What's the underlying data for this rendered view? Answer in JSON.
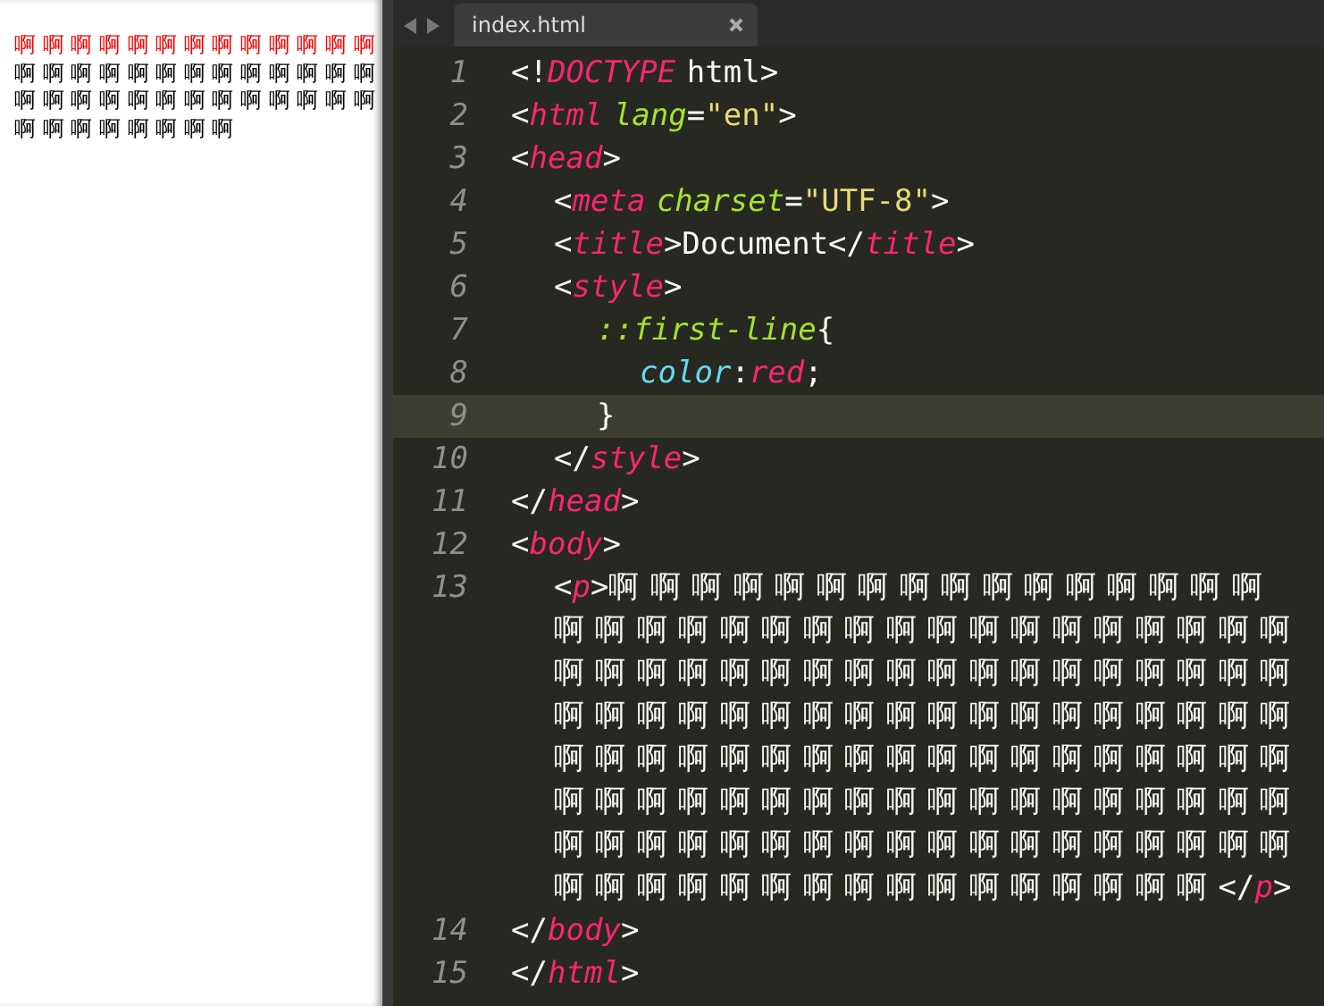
{
  "browser": {
    "lines": [
      {
        "text": "啊 啊 啊 啊 啊 啊 啊 啊 啊 啊 啊 啊 啊",
        "first_line": true
      },
      {
        "text": "啊 啊 啊 啊 啊 啊 啊 啊 啊 啊 啊 啊 啊",
        "first_line": false
      },
      {
        "text": "啊 啊 啊 啊 啊 啊 啊 啊 啊 啊 啊 啊 啊",
        "first_line": false
      },
      {
        "text": "啊 啊 啊 啊 啊 啊 啊 啊",
        "first_line": false
      }
    ]
  },
  "editor": {
    "tabs": [
      {
        "label": "index.html",
        "selected": true
      }
    ],
    "lines": [
      {
        "number": "1",
        "current": false,
        "wraps": [
          [
            {
              "text": "<!",
              "kind": "punct"
            },
            {
              "text": "DOCTYPE",
              "kind": "tag"
            },
            {
              "text": " html>",
              "kind": "punct"
            }
          ]
        ]
      },
      {
        "number": "2",
        "current": false,
        "wraps": [
          [
            {
              "text": "<",
              "kind": "punct"
            },
            {
              "text": "html",
              "kind": "tag"
            },
            {
              "text": " lang",
              "kind": "attr"
            },
            {
              "text": "=",
              "kind": "punct"
            },
            {
              "text": "\"en\"",
              "kind": "string"
            },
            {
              "text": ">",
              "kind": "punct"
            }
          ]
        ]
      },
      {
        "number": "3",
        "current": false,
        "wraps": [
          [
            {
              "text": "<",
              "kind": "punct"
            },
            {
              "text": "head",
              "kind": "tag"
            },
            {
              "text": ">",
              "kind": "punct"
            }
          ]
        ],
        "children": [
          {
            "number": "4",
            "current": false,
            "wraps": [
              [
                {
                  "text": "<",
                  "kind": "punct"
                },
                {
                  "text": "meta",
                  "kind": "tag"
                },
                {
                  "text": " charset",
                  "kind": "attr"
                },
                {
                  "text": "=",
                  "kind": "punct"
                },
                {
                  "text": "\"UTF-8\"",
                  "kind": "string"
                },
                {
                  "text": ">",
                  "kind": "punct"
                }
              ]
            ]
          },
          {
            "number": "5",
            "current": false,
            "wraps": [
              [
                {
                  "text": "<",
                  "kind": "punct"
                },
                {
                  "text": "title",
                  "kind": "tag"
                },
                {
                  "text": ">Document</",
                  "kind": "punct"
                },
                {
                  "text": "title",
                  "kind": "tag"
                },
                {
                  "text": ">",
                  "kind": "punct"
                }
              ]
            ]
          },
          {
            "number": "6",
            "current": false,
            "wraps": [
              [
                {
                  "text": "<",
                  "kind": "punct"
                },
                {
                  "text": "style",
                  "kind": "tag"
                },
                {
                  "text": ">",
                  "kind": "punct"
                }
              ]
            ],
            "children": [
              {
                "number": "7",
                "current": false,
                "wraps": [
                  [
                    {
                      "text": "::first-line",
                      "kind": "attr"
                    },
                    {
                      "text": "{",
                      "kind": "punct"
                    }
                  ]
                ],
                "children": [
                  {
                    "number": "8",
                    "current": false,
                    "wraps": [
                      [
                        {
                          "text": "color",
                          "kind": "prop"
                        },
                        {
                          "text": ":",
                          "kind": "punct"
                        },
                        {
                          "text": "red",
                          "kind": "value"
                        },
                        {
                          "text": ";",
                          "kind": "punct"
                        }
                      ]
                    ]
                  }
                ]
              },
              {
                "number": "9",
                "current": true,
                "wraps": [
                  [
                    {
                      "text": "}",
                      "kind": "punct"
                    }
                  ]
                ]
              }
            ]
          },
          {
            "number": "10",
            "current": false,
            "wraps": [
              [
                {
                  "text": "</",
                  "kind": "punct"
                },
                {
                  "text": "style",
                  "kind": "tag"
                },
                {
                  "text": ">",
                  "kind": "punct"
                }
              ]
            ]
          }
        ]
      },
      {
        "number": "11",
        "current": false,
        "wraps": [
          [
            {
              "text": "</",
              "kind": "punct"
            },
            {
              "text": "head",
              "kind": "tag"
            },
            {
              "text": ">",
              "kind": "punct"
            }
          ]
        ]
      },
      {
        "number": "12",
        "current": false,
        "wraps": [
          [
            {
              "text": "<",
              "kind": "punct"
            },
            {
              "text": "body",
              "kind": "tag"
            },
            {
              "text": ">",
              "kind": "punct"
            }
          ]
        ],
        "children": [
          {
            "number": "13",
            "current": false,
            "wraps": [
              [
                {
                  "text": "<",
                  "kind": "punct"
                },
                {
                  "text": "p",
                  "kind": "tag"
                },
                {
                  "text": ">啊 啊 啊 啊 啊 啊 啊 啊 啊 啊 啊 啊 啊 啊 啊 啊",
                  "kind": "punct"
                }
              ],
              [
                {
                  "text": "啊 啊 啊 啊 啊 啊 啊 啊 啊 啊 啊 啊 啊 啊 啊 啊 啊 啊",
                  "kind": "punct"
                }
              ],
              [
                {
                  "text": "啊 啊 啊 啊 啊 啊 啊 啊 啊 啊 啊 啊 啊 啊 啊 啊 啊 啊",
                  "kind": "punct"
                }
              ],
              [
                {
                  "text": "啊 啊 啊 啊 啊 啊 啊 啊 啊 啊 啊 啊 啊 啊 啊 啊 啊 啊",
                  "kind": "punct"
                }
              ],
              [
                {
                  "text": "啊 啊 啊 啊 啊 啊 啊 啊 啊 啊 啊 啊 啊 啊 啊 啊 啊 啊",
                  "kind": "punct"
                }
              ],
              [
                {
                  "text": "啊 啊 啊 啊 啊 啊 啊 啊 啊 啊 啊 啊 啊 啊 啊 啊 啊 啊",
                  "kind": "punct"
                }
              ],
              [
                {
                  "text": "啊 啊 啊 啊 啊 啊 啊 啊 啊 啊 啊 啊 啊 啊 啊 啊 啊 啊",
                  "kind": "punct"
                }
              ],
              [
                {
                  "text": "啊 啊 啊 啊 啊 啊 啊 啊 啊 啊 啊 啊 啊 啊 啊 啊 </",
                  "kind": "punct"
                },
                {
                  "text": "p",
                  "kind": "tag"
                },
                {
                  "text": ">",
                  "kind": "punct"
                }
              ]
            ]
          }
        ]
      },
      {
        "number": "14",
        "current": false,
        "wraps": [
          [
            {
              "text": "</",
              "kind": "punct"
            },
            {
              "text": "body",
              "kind": "tag"
            },
            {
              "text": ">",
              "kind": "punct"
            }
          ]
        ]
      },
      {
        "number": "15",
        "current": false,
        "wraps": [
          [
            {
              "text": "</",
              "kind": "punct"
            },
            {
              "text": "html",
              "kind": "tag"
            },
            {
              "text": ">",
              "kind": "punct"
            }
          ]
        ]
      }
    ]
  }
}
